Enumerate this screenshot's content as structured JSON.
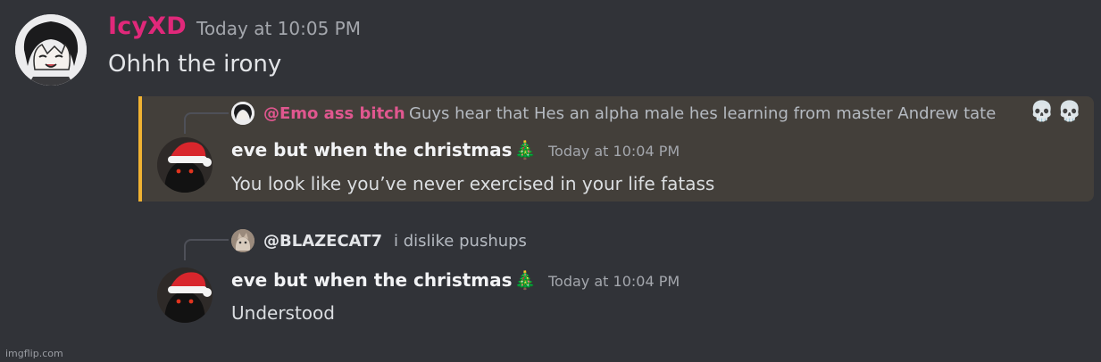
{
  "messages": {
    "first": {
      "username": "IcyXD",
      "timestamp": "Today at 10:05 PM",
      "text": "Ohhh the irony"
    },
    "second": {
      "reply": {
        "mention": "@Emo ass bitch",
        "text": "Guys hear that  Hes an alpha male hes learning from master Andrew tate",
        "emoji": "💀💀"
      },
      "username": "eve but when the christmas",
      "username_emoji": "🎄",
      "timestamp": "Today at 10:04 PM",
      "text": "You look like you’ve never exercised in your life fatass"
    },
    "third": {
      "reply": {
        "mention": "@BLAZECAT7",
        "text": "i dislike pushups"
      },
      "username": "eve but when the christmas",
      "username_emoji": "🎄",
      "timestamp": "Today at 10:04 PM",
      "text": "Understood"
    }
  },
  "watermark": "imgflip.com",
  "colors": {
    "background": "#313338",
    "highlight_bg": "#433f3a",
    "highlight_bar": "#f0b232",
    "icyxd_name": "#e0287a",
    "mention_name": "#e0578f"
  }
}
